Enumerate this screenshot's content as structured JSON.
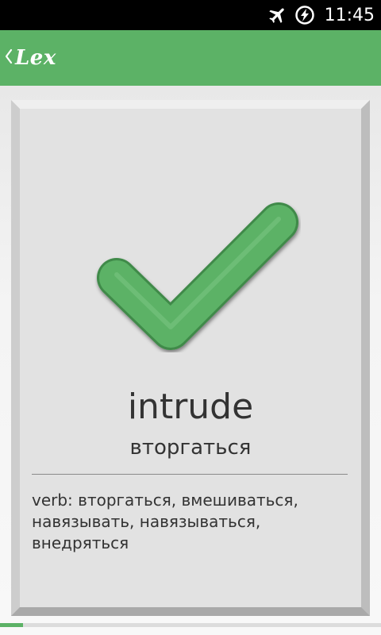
{
  "status_bar": {
    "time": "11:45",
    "icons": [
      "airplane-mode-icon",
      "battery-charging-icon"
    ]
  },
  "app_bar": {
    "title": "Lex",
    "back_icon": "chevron-left-icon",
    "color": "#5cb266"
  },
  "card": {
    "result_icon": "checkmark-icon",
    "result_color": "#5cb266",
    "word": "intrude",
    "translation": "вторгаться",
    "definition": "verb: вторгаться, вмешиваться, навязывать, навязываться, внедряться"
  },
  "progress": {
    "fraction": 0.06,
    "color": "#5cb266"
  }
}
